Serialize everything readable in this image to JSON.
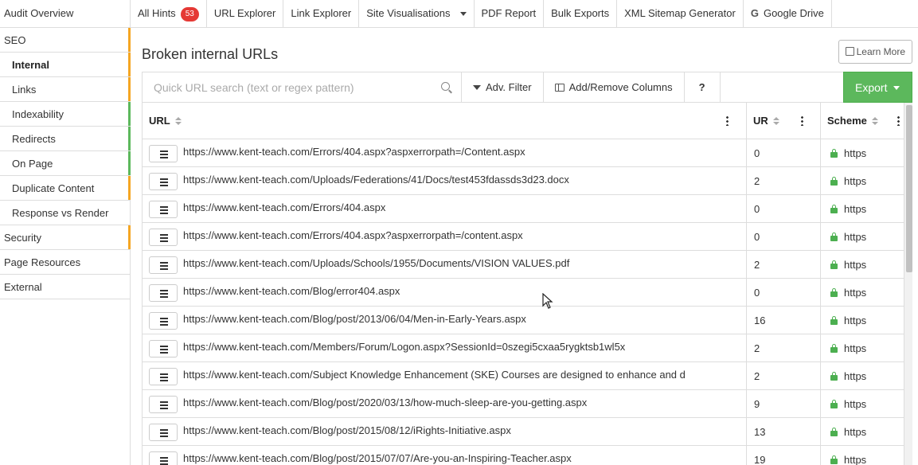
{
  "topbar": {
    "brand": "Audit Overview",
    "tabs": [
      {
        "label": "All Hints",
        "badge": "53"
      },
      {
        "label": "URL Explorer"
      },
      {
        "label": "Link Explorer"
      },
      {
        "label": "Site Visualisations",
        "dropdown": true
      },
      {
        "label": "PDF Report"
      },
      {
        "label": "Bulk Exports"
      },
      {
        "label": "XML Sitemap Generator"
      },
      {
        "label": "Google Drive",
        "icon": "google-icon"
      }
    ]
  },
  "sidebar": {
    "items": [
      {
        "label": "SEO",
        "accent": "#f5a623"
      },
      {
        "label": "Internal",
        "accent": "#f5a623",
        "active": true
      },
      {
        "label": "Links",
        "accent": "#f5a623"
      },
      {
        "label": "Indexability",
        "accent": "#5cb85c"
      },
      {
        "label": "Redirects",
        "accent": "#5cb85c"
      },
      {
        "label": "On Page",
        "accent": "#5cb85c"
      },
      {
        "label": "Duplicate Content",
        "accent": "#f5a623"
      },
      {
        "label": "Response vs Render",
        "accent": ""
      },
      {
        "label": "Security",
        "accent": "#f5a623"
      },
      {
        "label": "Page Resources",
        "accent": ""
      },
      {
        "label": "External",
        "accent": ""
      }
    ]
  },
  "main": {
    "title": "Broken internal URLs",
    "learn_more": "Learn More",
    "search_placeholder": "Quick URL search (text or regex pattern)",
    "adv_filter": "Adv. Filter",
    "columns_btn": "Add/Remove Columns",
    "help": "?",
    "export": "Export"
  },
  "table": {
    "columns": [
      "URL",
      "UR",
      "Scheme"
    ],
    "rows": [
      {
        "url": "https://www.kent-teach.com/Errors/404.aspx?aspxerrorpath=/Content.aspx",
        "ur": "0",
        "scheme": "https"
      },
      {
        "url": "https://www.kent-teach.com/Uploads/Federations/41/Docs/test453fdassds3d23.docx",
        "ur": "2",
        "scheme": "https"
      },
      {
        "url": "https://www.kent-teach.com/Errors/404.aspx",
        "ur": "0",
        "scheme": "https"
      },
      {
        "url": "https://www.kent-teach.com/Errors/404.aspx?aspxerrorpath=/content.aspx",
        "ur": "0",
        "scheme": "https"
      },
      {
        "url": "https://www.kent-teach.com/Uploads/Schools/1955/Documents/VISION VALUES.pdf",
        "ur": "2",
        "scheme": "https"
      },
      {
        "url": "https://www.kent-teach.com/Blog/error404.aspx",
        "ur": "0",
        "scheme": "https"
      },
      {
        "url": "https://www.kent-teach.com/Blog/post/2013/06/04/Men-in-Early-Years.aspx",
        "ur": "16",
        "scheme": "https"
      },
      {
        "url": "https://www.kent-teach.com/Members/Forum/Logon.aspx?SessionId=0szegi5cxaa5rygktsb1wl5x",
        "ur": "2",
        "scheme": "https"
      },
      {
        "url": "https://www.kent-teach.com/Subject Knowledge Enhancement (SKE) Courses are designed to enhance and d",
        "ur": "2",
        "scheme": "https"
      },
      {
        "url": "https://www.kent-teach.com/Blog/post/2020/03/13/how-much-sleep-are-you-getting.aspx",
        "ur": "9",
        "scheme": "https"
      },
      {
        "url": "https://www.kent-teach.com/Blog/post/2015/08/12/iRights-Initiative.aspx",
        "ur": "13",
        "scheme": "https"
      },
      {
        "url": "https://www.kent-teach.com/Blog/post/2015/07/07/Are-you-an-Inspiring-Teacher.aspx",
        "ur": "19",
        "scheme": "https"
      }
    ]
  },
  "colors": {
    "orange_accent": "#f5a623",
    "green_accent": "#5cb85c",
    "badge_red": "#e53935",
    "export_green": "#5cb85c"
  }
}
